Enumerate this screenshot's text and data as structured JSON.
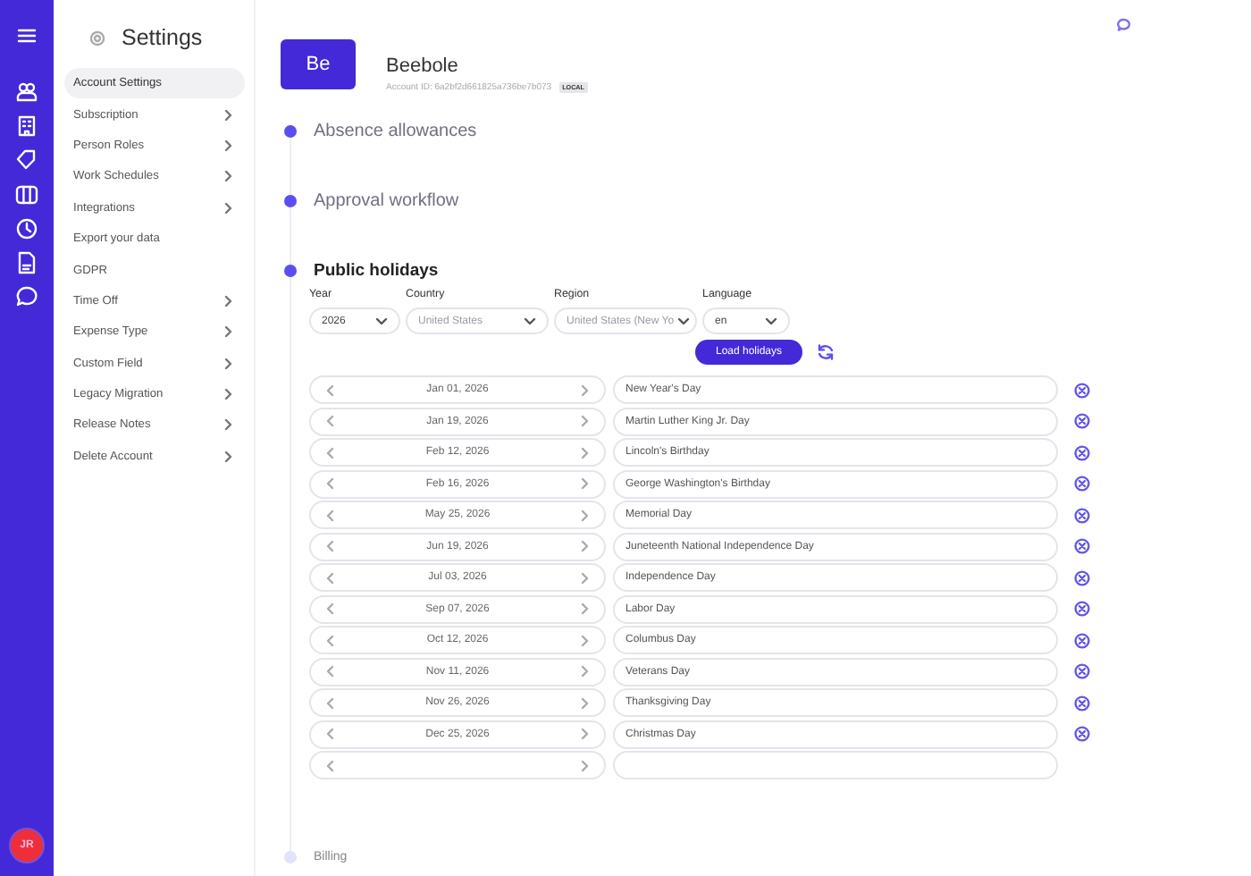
{
  "rail": {
    "avatar": "JR",
    "items": [
      {
        "kind": "people",
        "selected": false
      },
      {
        "kind": "building",
        "selected": false
      },
      {
        "kind": "tag",
        "selected": false
      },
      {
        "kind": "columns",
        "selected": false
      },
      {
        "kind": "clock",
        "selected": false
      },
      {
        "kind": "document",
        "selected": false
      },
      {
        "kind": "chat",
        "selected": false
      }
    ]
  },
  "sidebar": {
    "title": "Settings",
    "items": [
      {
        "label": "Account Settings",
        "selected": true,
        "has_children": false
      },
      {
        "label": "Subscription",
        "selected": false,
        "has_children": true
      },
      {
        "label": "Person Roles",
        "selected": false,
        "has_children": true
      },
      {
        "label": "Work Schedules",
        "selected": false,
        "has_children": true
      },
      {
        "label": "Integrations",
        "selected": false,
        "has_children": true
      },
      {
        "label": "Export your data",
        "selected": false,
        "has_children": false
      },
      {
        "label": "GDPR",
        "selected": false,
        "has_children": false
      },
      {
        "label": "Time Off",
        "selected": false,
        "has_children": true
      },
      {
        "label": "Expense Type",
        "selected": false,
        "has_children": true
      },
      {
        "label": "Custom Field",
        "selected": false,
        "has_children": true
      },
      {
        "label": "Legacy Migration",
        "selected": false,
        "has_children": true
      },
      {
        "label": "Release Notes",
        "selected": false,
        "has_children": true
      },
      {
        "label": "Delete Account",
        "selected": false,
        "has_children": true
      }
    ]
  },
  "account": {
    "initials": "Be",
    "name": "Beebole",
    "account_id": "Account ID: 6a2bf2d661825a736be7b073",
    "badge": "LOCAL"
  },
  "sections": [
    {
      "title": "Absence allowances",
      "expanded": false,
      "dimmed": false
    },
    {
      "title": "Approval workflow",
      "expanded": false,
      "dimmed": false
    },
    {
      "title": "Public holidays",
      "expanded": true,
      "dimmed": false
    },
    {
      "title": "Billing",
      "expanded": false,
      "dimmed": true
    }
  ],
  "public_holidays": {
    "filters": [
      {
        "label": "Year",
        "value": "2026",
        "kind": "value"
      },
      {
        "label": "Country",
        "value": "United States",
        "kind": "muted"
      },
      {
        "label": "Region",
        "value": "United States (New Yo",
        "kind": "muted"
      },
      {
        "label": "Language",
        "value": "en",
        "kind": "value"
      }
    ],
    "load_button": "Load holidays",
    "holidays": [
      {
        "date": "Jan 01, 2026",
        "name": "New Year's Day"
      },
      {
        "date": "Jan 19, 2026",
        "name": "Martin Luther King Jr. Day"
      },
      {
        "date": "Feb 12, 2026",
        "name": "Lincoln's Birthday"
      },
      {
        "date": "Feb 16, 2026",
        "name": "George Washington's Birthday"
      },
      {
        "date": "May 25, 2026",
        "name": "Memorial Day"
      },
      {
        "date": "Jun 19, 2026",
        "name": "Juneteenth National Independence Day"
      },
      {
        "date": "Jul 03, 2026",
        "name": "Independence Day"
      },
      {
        "date": "Sep 07, 2026",
        "name": "Labor Day"
      },
      {
        "date": "Oct 12, 2026",
        "name": "Columbus Day"
      },
      {
        "date": "Nov 11, 2026",
        "name": "Veterans Day"
      },
      {
        "date": "Nov 26, 2026",
        "name": "Thanksgiving Day"
      },
      {
        "date": "Dec 25, 2026",
        "name": "Christmas Day"
      }
    ],
    "new_row": true
  }
}
